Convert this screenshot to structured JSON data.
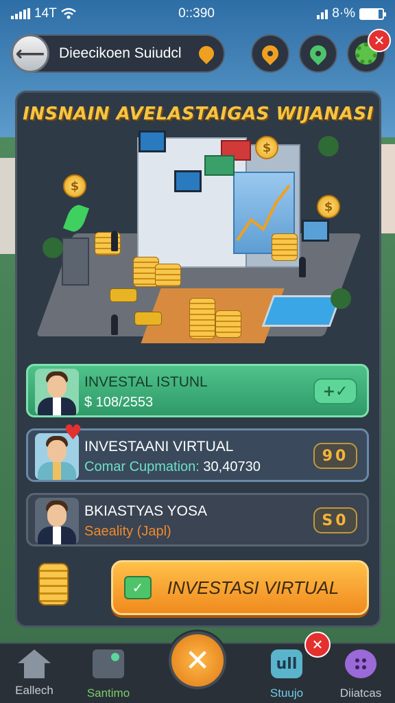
{
  "status_bar": {
    "carrier": "14T",
    "time": "0::390",
    "battery_text": "8·%"
  },
  "top_bar": {
    "title": "Dieecikoen Suiudcl"
  },
  "panel": {
    "title": "INSNAIN AVELASTAIGAS WIJANASI"
  },
  "coin_symbol": "$",
  "investments": [
    {
      "name": "INVESTAL ISTUNL",
      "detail": "$ 108/2553",
      "action_label": "+✓"
    },
    {
      "name": "INVESTAANI VIRTUAL",
      "detail_label": "Comar Cupmation:",
      "detail_value": "30,40730",
      "action_label": "90"
    },
    {
      "name": "BKIASTYAS YOSA",
      "detail": "Saeality (Japl)",
      "action_label": "S0"
    }
  ],
  "cta": {
    "label": "INVESTASI VIRTUAL",
    "icon": "check-folder-icon"
  },
  "bottom_nav": {
    "items": [
      {
        "label": "Eallech",
        "icon": "home-icon"
      },
      {
        "label": "Santimo",
        "icon": "tools-icon"
      },
      {
        "label": "Stuujo",
        "icon": "studio-icon",
        "icon_text": "ull"
      },
      {
        "label": "Diiatcas",
        "icon": "dots-icon"
      }
    ],
    "center_icon": "close-x-icon"
  },
  "colors": {
    "accent_orange": "#f08a1e",
    "title_gold": "#f5c542",
    "active_green": "#4fc28a",
    "alert_red": "#e53030"
  }
}
